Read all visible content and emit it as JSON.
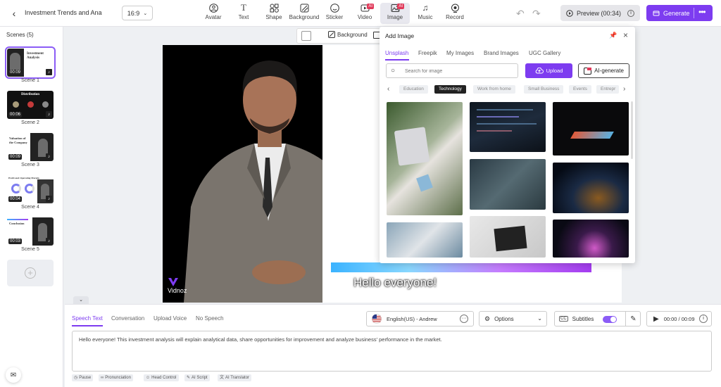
{
  "header": {
    "project_title": "Investment Trends and Anal...",
    "aspect_ratio": "16:9",
    "tools": [
      {
        "label": "Avatar",
        "icon": "avatar-icon"
      },
      {
        "label": "Text",
        "icon": "text-icon"
      },
      {
        "label": "Shape",
        "icon": "shape-icon"
      },
      {
        "label": "Background",
        "icon": "background-icon"
      },
      {
        "label": "Sticker",
        "icon": "sticker-icon"
      },
      {
        "label": "Video",
        "icon": "video-icon",
        "badge": "AI"
      },
      {
        "label": "Image",
        "icon": "image-icon",
        "badge": "AI",
        "active": true
      },
      {
        "label": "Music",
        "icon": "music-icon"
      },
      {
        "label": "Record",
        "icon": "record-icon"
      }
    ],
    "preview_label": "Preview (00:34)",
    "generate_label": "Generate",
    "accent": "#7d3cf0"
  },
  "scenes": {
    "title": "Scenes (5)",
    "items": [
      {
        "label": "Scene 1",
        "duration": "00:09",
        "heading": "Investment Analysis"
      },
      {
        "label": "Scene 2",
        "duration": "00:06",
        "heading": "Distribution"
      },
      {
        "label": "Scene 3",
        "duration": "00:09",
        "heading": "Valuation of the Company"
      },
      {
        "label": "Scene 4",
        "duration": "00:04",
        "heading": "Profit and Operating Margin"
      },
      {
        "label": "Scene 5",
        "duration": "00:03",
        "heading": "Conclusion"
      }
    ]
  },
  "canvas": {
    "toolbar_background": "Background",
    "subtitle": "Hello everyone!",
    "watermark": "Vidnoz"
  },
  "add_image": {
    "title": "Add Image",
    "tabs": [
      "Unsplash",
      "Freepik",
      "My Images",
      "Brand Images",
      "UGC Gallery"
    ],
    "active_tab": "Unsplash",
    "search_placeholder": "Search for image",
    "upload_label": "Upload",
    "ai_generate_label": "AI-generate",
    "categories": [
      "Education",
      "Technology",
      "Work from home",
      "Small Business",
      "Events",
      "Entrepr"
    ],
    "active_category": "Technology"
  },
  "bottom": {
    "tabs": [
      "Speech Text",
      "Conversation",
      "Upload Voice",
      "No Speech"
    ],
    "voice": "English(US) - Andrew",
    "options_label": "Options",
    "subtitles_label": "Subtitles",
    "time": "00:00 / 00:09",
    "script": "Hello everyone! This investment analysis will explain analytical data, share opportunities for improvement and analyze business' performance in the market.",
    "chips": [
      "Pause",
      "Pronunciation",
      "Head Control",
      "AI Script",
      "AI Translator"
    ]
  }
}
